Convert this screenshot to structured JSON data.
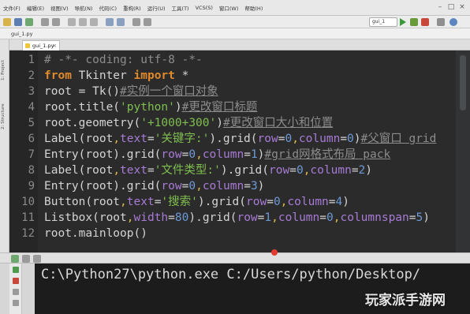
{
  "menu": [
    "文件(F)",
    "编辑(E)",
    "视图(V)",
    "导航(N)",
    "代码(C)",
    "重构(R)",
    "运行(U)",
    "工具(T)",
    "VCS(S)",
    "窗口(W)",
    "帮助(H)"
  ],
  "toolbar": {
    "run_config": "gui_1"
  },
  "navbar": {
    "file": "gui_1.py"
  },
  "side_labels": {
    "project": "1: Project",
    "structure": "2: Structure"
  },
  "editor_tab": {
    "label": "gui_1.py",
    "close": "×"
  },
  "editor": {
    "lines": [
      {
        "num": "1",
        "parts": [
          {
            "t": "# -*- coding: utf-8 -*-",
            "c": "cm"
          }
        ]
      },
      {
        "num": "2",
        "parts": [
          {
            "t": "from",
            "c": "kw"
          },
          {
            "t": " Tkinter ",
            "c": ""
          },
          {
            "t": "import",
            "c": "kw"
          },
          {
            "t": " *",
            "c": ""
          }
        ]
      },
      {
        "num": "3",
        "parts": [
          {
            "t": "root = Tk()",
            "c": ""
          },
          {
            "t": "#实例一个窗口对象",
            "c": "cmu"
          }
        ]
      },
      {
        "num": "4",
        "parts": [
          {
            "t": "root.title(",
            "c": ""
          },
          {
            "t": "'python'",
            "c": "st"
          },
          {
            "t": ")",
            "c": ""
          },
          {
            "t": "#更改窗口标题",
            "c": "cmu"
          }
        ]
      },
      {
        "num": "5",
        "parts": [
          {
            "t": "root.geometry(",
            "c": ""
          },
          {
            "t": "'+1000+300'",
            "c": "st"
          },
          {
            "t": ")",
            "c": ""
          },
          {
            "t": "#更改窗口大小和位置",
            "c": "cmu"
          }
        ]
      },
      {
        "num": "6",
        "parts": [
          {
            "t": "Label(root",
            "c": ""
          },
          {
            "t": ",",
            "c": "cs"
          },
          {
            "t": "text",
            "c": "pk"
          },
          {
            "t": "=",
            "c": ""
          },
          {
            "t": "'关键字:'",
            "c": "st"
          },
          {
            "t": ").grid(",
            "c": ""
          },
          {
            "t": "row",
            "c": "pk"
          },
          {
            "t": "=",
            "c": ""
          },
          {
            "t": "0",
            "c": "nm"
          },
          {
            "t": ",",
            "c": "cs"
          },
          {
            "t": "column",
            "c": "pk"
          },
          {
            "t": "=",
            "c": ""
          },
          {
            "t": "0",
            "c": "nm"
          },
          {
            "t": ")",
            "c": ""
          },
          {
            "t": "#父窗口 grid",
            "c": "cmu"
          }
        ]
      },
      {
        "num": "7",
        "parts": [
          {
            "t": "Entry(root).grid(",
            "c": ""
          },
          {
            "t": "row",
            "c": "pk"
          },
          {
            "t": "=",
            "c": ""
          },
          {
            "t": "0",
            "c": "nm"
          },
          {
            "t": ",",
            "c": "cs"
          },
          {
            "t": "column",
            "c": "pk"
          },
          {
            "t": "=",
            "c": ""
          },
          {
            "t": "1",
            "c": "nm"
          },
          {
            "t": ")",
            "c": ""
          },
          {
            "t": "#grid网格式布局 pack",
            "c": "cmu"
          }
        ]
      },
      {
        "num": "8",
        "parts": [
          {
            "t": "Label(root",
            "c": ""
          },
          {
            "t": ",",
            "c": "cs"
          },
          {
            "t": "text",
            "c": "pk"
          },
          {
            "t": "=",
            "c": ""
          },
          {
            "t": "'文件类型:'",
            "c": "st"
          },
          {
            "t": ").grid(",
            "c": ""
          },
          {
            "t": "row",
            "c": "pk"
          },
          {
            "t": "=",
            "c": ""
          },
          {
            "t": "0",
            "c": "nm"
          },
          {
            "t": ",",
            "c": "cs"
          },
          {
            "t": "column",
            "c": "pk"
          },
          {
            "t": "=",
            "c": ""
          },
          {
            "t": "2",
            "c": "nm"
          },
          {
            "t": ")",
            "c": ""
          }
        ]
      },
      {
        "num": "9",
        "parts": [
          {
            "t": "Entry(root).grid(",
            "c": ""
          },
          {
            "t": "row",
            "c": "pk"
          },
          {
            "t": "=",
            "c": ""
          },
          {
            "t": "0",
            "c": "nm"
          },
          {
            "t": ",",
            "c": "cs"
          },
          {
            "t": "column",
            "c": "pk"
          },
          {
            "t": "=",
            "c": ""
          },
          {
            "t": "3",
            "c": "nm"
          },
          {
            "t": ")",
            "c": ""
          }
        ]
      },
      {
        "num": "10",
        "parts": [
          {
            "t": "Button(root",
            "c": ""
          },
          {
            "t": ",",
            "c": "cs"
          },
          {
            "t": "text",
            "c": "pk"
          },
          {
            "t": "=",
            "c": ""
          },
          {
            "t": "'搜索'",
            "c": "st"
          },
          {
            "t": ").grid(",
            "c": ""
          },
          {
            "t": "row",
            "c": "pk"
          },
          {
            "t": "=",
            "c": ""
          },
          {
            "t": "0",
            "c": "nm"
          },
          {
            "t": ",",
            "c": "cs"
          },
          {
            "t": "column",
            "c": "pk"
          },
          {
            "t": "=",
            "c": ""
          },
          {
            "t": "4",
            "c": "nm"
          },
          {
            "t": ")",
            "c": ""
          }
        ]
      },
      {
        "num": "11",
        "parts": [
          {
            "t": "Listbox(root",
            "c": ""
          },
          {
            "t": ",",
            "c": "cs"
          },
          {
            "t": "width",
            "c": "pk"
          },
          {
            "t": "=",
            "c": ""
          },
          {
            "t": "80",
            "c": "nm"
          },
          {
            "t": ").grid(",
            "c": ""
          },
          {
            "t": "row",
            "c": "pk"
          },
          {
            "t": "=",
            "c": ""
          },
          {
            "t": "1",
            "c": "nm"
          },
          {
            "t": ",",
            "c": "cs"
          },
          {
            "t": "column",
            "c": "pk"
          },
          {
            "t": "=",
            "c": ""
          },
          {
            "t": "0",
            "c": "nm"
          },
          {
            "t": ",",
            "c": "cs"
          },
          {
            "t": "columnspan",
            "c": "pk"
          },
          {
            "t": "=",
            "c": ""
          },
          {
            "t": "5",
            "c": "nm"
          },
          {
            "t": ")",
            "c": ""
          }
        ]
      },
      {
        "num": "12",
        "parts": [
          {
            "t": "root.mainloop()",
            "c": ""
          }
        ]
      }
    ]
  },
  "console": {
    "command": "C:\\Python27\\python.exe C:/Users/python/Desktop/"
  },
  "watermark": "玩家派手游网",
  "colors": {
    "editor_bg": "#2b2b2b",
    "keyword": "#e08a2b",
    "string": "#7fbf4f",
    "number": "#6d9ad6",
    "param": "#a77bd6",
    "comment": "#8c8c8c"
  }
}
